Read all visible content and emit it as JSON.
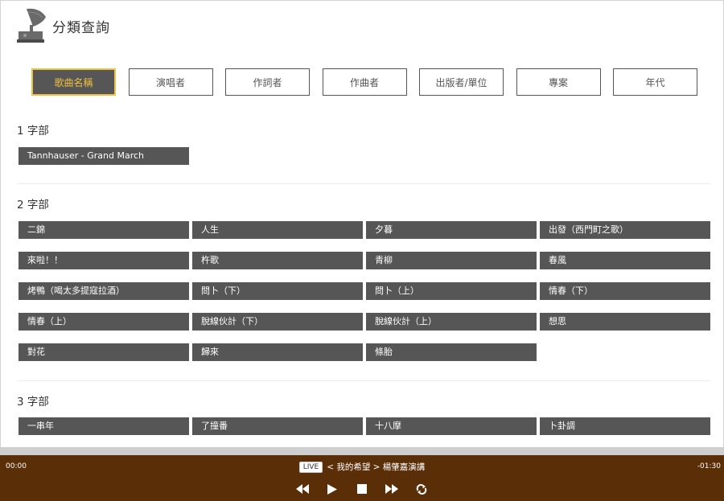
{
  "header": {
    "title": "分類查詢",
    "logo_icon": "gramophone-icon"
  },
  "filter_tabs": [
    {
      "label": "歌曲名稱",
      "active": true
    },
    {
      "label": "演唱者",
      "active": false
    },
    {
      "label": "作詞者",
      "active": false
    },
    {
      "label": "作曲者",
      "active": false
    },
    {
      "label": "出版者/單位",
      "active": false
    },
    {
      "label": "專案",
      "active": false
    },
    {
      "label": "年代",
      "active": false
    }
  ],
  "sections": [
    {
      "heading": "1 字部",
      "songs": [
        "Tannhauser - Grand March"
      ]
    },
    {
      "heading": "2 字部",
      "songs": [
        "二錦",
        "人生",
        "夕暮",
        "出發（西門町之歌）",
        "來啦！！",
        "杵歌",
        "青柳",
        "春風",
        "烤鴨（喝太多提寇拉酒）",
        "問卜（下）",
        "問卜（上）",
        "情春（下）",
        "情春（上）",
        "脫線伙計（下）",
        "脫線伙計（上）",
        "想思",
        "對花",
        "歸來",
        "條胎"
      ]
    },
    {
      "heading": "3 字部",
      "songs": [
        "一串年",
        "了撞番",
        "十八摩",
        "卜卦調"
      ]
    }
  ],
  "player": {
    "time_elapsed": "00:00",
    "time_remaining": "-01:30",
    "live_label": "LIVE",
    "now_playing": "< 我的希望 > 楊肇嘉演講",
    "controls": [
      "rewind-icon",
      "play-icon",
      "stop-icon",
      "fast-forward-icon",
      "repeat-icon"
    ]
  },
  "colors": {
    "accent": "#f0c040",
    "tile": "#565656",
    "player_bg": "#5a2e07"
  }
}
